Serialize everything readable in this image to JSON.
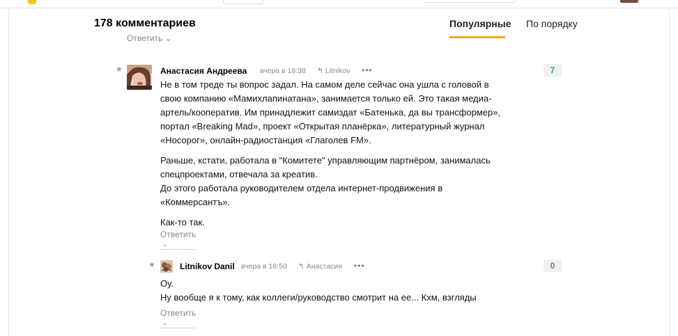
{
  "header": {
    "count_label": "178 комментариев",
    "sort_tabs": [
      "Популярные",
      "По порядку"
    ]
  },
  "prev_reply_label": "Ответить",
  "comments": [
    {
      "author": "Анастасия Андреева",
      "time": "вчера в 18:38",
      "reply_to": "Litnikov",
      "more": "•••",
      "rating": "7",
      "rating_color": "#21a843",
      "paragraphs": [
        [
          "Не в том треде ты вопрос задал. На самом деле сейчас она ушла с головой в",
          "свою компанию «Мамихлапинатана», занимается только ей. Это такая медиа-",
          "артель/кооператив. Им принадлежит самиздат «Батенька, да вы трансформер»,",
          "портал «Breaking Mad», проект «Открытая планёрка», литературный журнал",
          "«Носорог», онлайн-радиостанция «Глаголев FM»."
        ],
        [
          "Раньше, кстати, работала в \"Комитете\" управляющим партнёром, занималась",
          "спецпроектами, отвечала за креатив.",
          "До этого работала руководителем отдела интернет-продвижения в",
          "«Коммерсантъ»."
        ],
        [
          "Как-то так."
        ]
      ],
      "reply_label": "Ответить"
    },
    {
      "author": "Litnikov Danil",
      "time": "вчера в 18:50",
      "reply_to": "Анастасия",
      "more": "•••",
      "rating": "0",
      "rating_color": "#777777",
      "paragraphs": [
        [
          "Оу.",
          "Ну вообще я к тому, как коллеги/руководство смотрит на ее... Кхм, взгляды"
        ]
      ],
      "reply_label": "Ответить"
    }
  ],
  "icons": {
    "star": "★",
    "reply_arrow": "↰",
    "chevron": "⌄"
  },
  "colors": {
    "accent": "#f5a623",
    "rating_bg": "#f0f0f0"
  }
}
